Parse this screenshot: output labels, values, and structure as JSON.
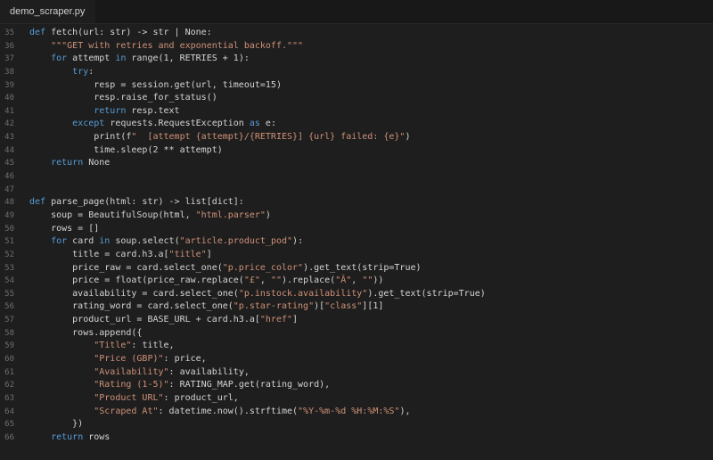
{
  "tab": {
    "filename": "demo_scraper.py"
  },
  "colors": {
    "background": "#1e1e1e",
    "tabbar": "#181818",
    "keyword": "#569cd6",
    "string": "#ce9178",
    "text": "#d4d4d4",
    "line_number": "#6e6e6e"
  },
  "lines": [
    {
      "num": "35",
      "tokens": [
        [
          "kw",
          "def"
        ],
        [
          "id",
          " fetch(url: str) -> str | None:"
        ]
      ]
    },
    {
      "num": "36",
      "tokens": [
        [
          "id",
          "    "
        ],
        [
          "str",
          "\"\"\"GET with retries and exponential backoff.\"\"\""
        ]
      ]
    },
    {
      "num": "37",
      "tokens": [
        [
          "id",
          "    "
        ],
        [
          "kw",
          "for"
        ],
        [
          "id",
          " attempt "
        ],
        [
          "kw",
          "in"
        ],
        [
          "id",
          " range(1, RETRIES + 1):"
        ]
      ]
    },
    {
      "num": "38",
      "tokens": [
        [
          "id",
          "        "
        ],
        [
          "kw",
          "try"
        ],
        [
          "id",
          ":"
        ]
      ]
    },
    {
      "num": "39",
      "tokens": [
        [
          "id",
          "            resp = session.get(url, timeout=15)"
        ]
      ]
    },
    {
      "num": "40",
      "tokens": [
        [
          "id",
          "            resp.raise_for_status()"
        ]
      ]
    },
    {
      "num": "41",
      "tokens": [
        [
          "id",
          "            "
        ],
        [
          "kw",
          "return"
        ],
        [
          "id",
          " resp.text"
        ]
      ]
    },
    {
      "num": "42",
      "tokens": [
        [
          "id",
          "        "
        ],
        [
          "kw",
          "except"
        ],
        [
          "id",
          " requests.RequestException "
        ],
        [
          "kw",
          "as"
        ],
        [
          "id",
          " e:"
        ]
      ]
    },
    {
      "num": "43",
      "tokens": [
        [
          "id",
          "            print(f"
        ],
        [
          "str",
          "\"  [attempt {attempt}/{RETRIES}] {url} failed: {e}\""
        ],
        [
          "id",
          ")"
        ]
      ]
    },
    {
      "num": "44",
      "tokens": [
        [
          "id",
          "            time.sleep(2 ** attempt)"
        ]
      ]
    },
    {
      "num": "45",
      "tokens": [
        [
          "id",
          "    "
        ],
        [
          "kw",
          "return"
        ],
        [
          "id",
          " None"
        ]
      ]
    },
    {
      "num": "46",
      "tokens": []
    },
    {
      "num": "47",
      "tokens": []
    },
    {
      "num": "48",
      "tokens": [
        [
          "kw",
          "def"
        ],
        [
          "id",
          " parse_page(html: str) -> list[dict]:"
        ]
      ]
    },
    {
      "num": "49",
      "tokens": [
        [
          "id",
          "    soup = BeautifulSoup(html, "
        ],
        [
          "str",
          "\"html.parser\""
        ],
        [
          "id",
          ")"
        ]
      ]
    },
    {
      "num": "50",
      "tokens": [
        [
          "id",
          "    rows = []"
        ]
      ]
    },
    {
      "num": "51",
      "tokens": [
        [
          "id",
          "    "
        ],
        [
          "kw",
          "for"
        ],
        [
          "id",
          " card "
        ],
        [
          "kw",
          "in"
        ],
        [
          "id",
          " soup.select("
        ],
        [
          "str",
          "\"article.product_pod\""
        ],
        [
          "id",
          "):"
        ]
      ]
    },
    {
      "num": "52",
      "tokens": [
        [
          "id",
          "        title = card.h3.a["
        ],
        [
          "str",
          "\"title\""
        ],
        [
          "id",
          "]"
        ]
      ]
    },
    {
      "num": "53",
      "tokens": [
        [
          "id",
          "        price_raw = card.select_one("
        ],
        [
          "str",
          "\"p.price_color\""
        ],
        [
          "id",
          ").get_text(strip=True)"
        ]
      ]
    },
    {
      "num": "54",
      "tokens": [
        [
          "id",
          "        price = float(price_raw.replace("
        ],
        [
          "str",
          "\"£\""
        ],
        [
          "id",
          ", "
        ],
        [
          "str",
          "\"\""
        ],
        [
          "id",
          ").replace("
        ],
        [
          "str",
          "\"Â\""
        ],
        [
          "id",
          ", "
        ],
        [
          "str",
          "\"\""
        ],
        [
          "id",
          "))"
        ]
      ]
    },
    {
      "num": "55",
      "tokens": [
        [
          "id",
          "        availability = card.select_one("
        ],
        [
          "str",
          "\"p.instock.availability\""
        ],
        [
          "id",
          ").get_text(strip=True)"
        ]
      ]
    },
    {
      "num": "56",
      "tokens": [
        [
          "id",
          "        rating_word = card.select_one("
        ],
        [
          "str",
          "\"p.star-rating\""
        ],
        [
          "id",
          ")["
        ],
        [
          "str",
          "\"class\""
        ],
        [
          "id",
          "][1]"
        ]
      ]
    },
    {
      "num": "57",
      "tokens": [
        [
          "id",
          "        product_url = BASE_URL + card.h3.a["
        ],
        [
          "str",
          "\"href\""
        ],
        [
          "id",
          "]"
        ]
      ]
    },
    {
      "num": "58",
      "tokens": [
        [
          "id",
          "        rows.append({"
        ]
      ]
    },
    {
      "num": "59",
      "tokens": [
        [
          "id",
          "            "
        ],
        [
          "str",
          "\"Title\""
        ],
        [
          "id",
          ": title,"
        ]
      ]
    },
    {
      "num": "60",
      "tokens": [
        [
          "id",
          "            "
        ],
        [
          "str",
          "\"Price (GBP)\""
        ],
        [
          "id",
          ": price,"
        ]
      ]
    },
    {
      "num": "61",
      "tokens": [
        [
          "id",
          "            "
        ],
        [
          "str",
          "\"Availability\""
        ],
        [
          "id",
          ": availability,"
        ]
      ]
    },
    {
      "num": "62",
      "tokens": [
        [
          "id",
          "            "
        ],
        [
          "str",
          "\"Rating (1-5)\""
        ],
        [
          "id",
          ": RATING_MAP.get(rating_word),"
        ]
      ]
    },
    {
      "num": "63",
      "tokens": [
        [
          "id",
          "            "
        ],
        [
          "str",
          "\"Product URL\""
        ],
        [
          "id",
          ": product_url,"
        ]
      ]
    },
    {
      "num": "64",
      "tokens": [
        [
          "id",
          "            "
        ],
        [
          "str",
          "\"Scraped At\""
        ],
        [
          "id",
          ": datetime.now().strftime("
        ],
        [
          "str",
          "\"%Y-%m-%d %H:%M:%S\""
        ],
        [
          "id",
          "),"
        ]
      ]
    },
    {
      "num": "65",
      "tokens": [
        [
          "id",
          "        })"
        ]
      ]
    },
    {
      "num": "66",
      "tokens": [
        [
          "id",
          "    "
        ],
        [
          "kw",
          "return"
        ],
        [
          "id",
          " rows"
        ]
      ]
    }
  ]
}
